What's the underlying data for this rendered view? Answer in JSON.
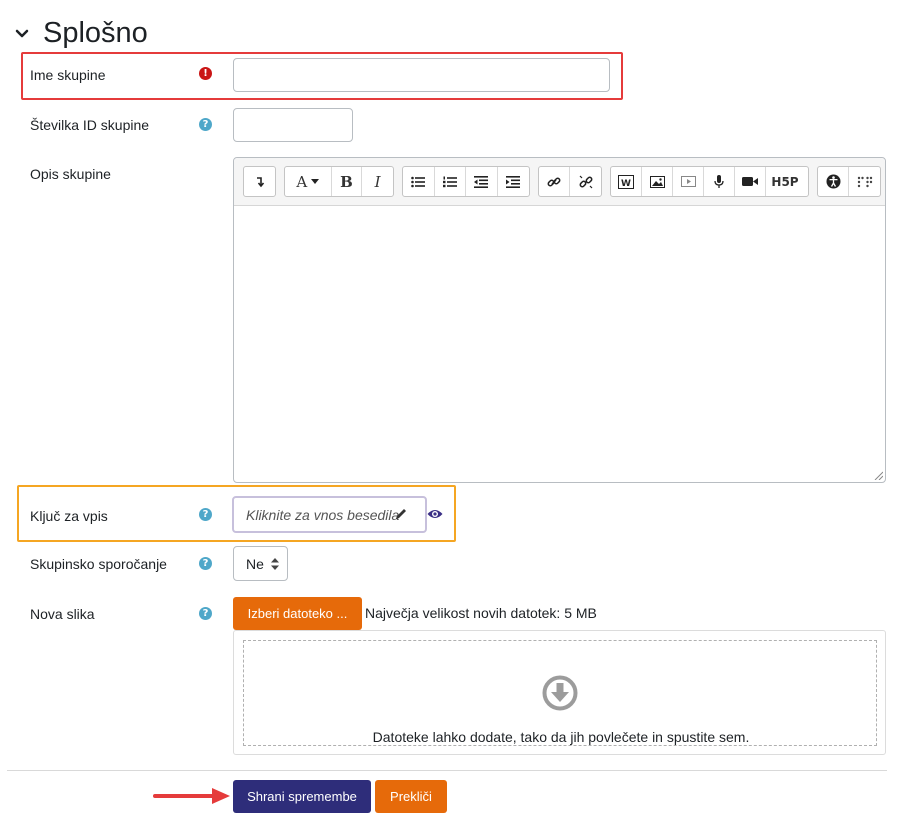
{
  "section": {
    "title": "Splošno"
  },
  "fields": {
    "group_name": {
      "label": "Ime skupine",
      "value": ""
    },
    "id_number": {
      "label": "Številka ID skupine",
      "value": ""
    },
    "description": {
      "label": "Opis skupine"
    },
    "enrolment_key": {
      "label": "Ključ za vpis",
      "placeholder": "Kliknite za vnos besedila"
    },
    "group_messaging": {
      "label": "Skupinsko sporočanje",
      "value": "Ne"
    },
    "new_picture": {
      "label": "Nova slika"
    }
  },
  "editor": {
    "toolbar": [
      {
        "group": "expand",
        "buttons": [
          "expand-toolbar-icon"
        ]
      },
      {
        "group": "style",
        "buttons": [
          "font-style-icon",
          "bold-icon",
          "italic-icon"
        ]
      },
      {
        "group": "lists",
        "buttons": [
          "unordered-list-icon",
          "ordered-list-icon",
          "outdent-icon",
          "indent-icon"
        ]
      },
      {
        "group": "links",
        "buttons": [
          "link-icon",
          "unlink-icon"
        ]
      },
      {
        "group": "media",
        "buttons": [
          "word-import-icon",
          "image-icon",
          "media-icon",
          "record-audio-icon",
          "record-video-icon",
          "h5p-icon"
        ]
      },
      {
        "group": "accessibility",
        "buttons": [
          "accessibility-checker-icon",
          "screenreader-helper-icon"
        ]
      }
    ],
    "font_button_label": "A",
    "bold_label": "B",
    "italic_label": "I",
    "h5p_label": "H5P"
  },
  "filepicker": {
    "choose_button": "Izberi datoteko ...",
    "max_size": "Največja velikost novih datotek: 5 MB",
    "drop_text": "Datoteke lahko dodate, tako da jih povlečete in spustite sem."
  },
  "actions": {
    "save": "Shrani spremembe",
    "cancel": "Prekliči"
  },
  "colors": {
    "required": "#ca1515",
    "help": "#4ea7c9",
    "primary": "#2e2d7a",
    "secondary": "#e66a0a",
    "highlight_red": "#e53b3b",
    "highlight_orange": "#f5a623"
  }
}
